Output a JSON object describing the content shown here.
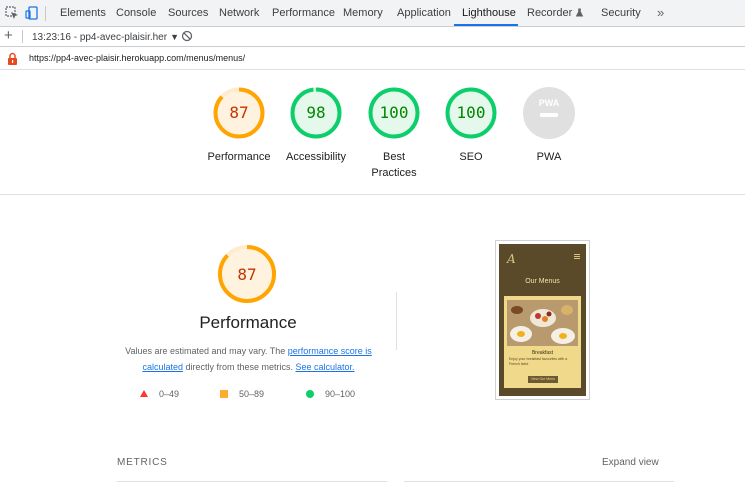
{
  "devtools": {
    "tabs": [
      "Elements",
      "Console",
      "Sources",
      "Network",
      "Performance",
      "Memory",
      "Application",
      "Lighthouse",
      "Recorder",
      "Security"
    ],
    "active_tab": "Lighthouse",
    "more_label": "»",
    "accent": "#1a73e8"
  },
  "report_toolbar": {
    "add_label": "+",
    "selected_report": "13:23:16 - pp4-avec-plaisir.her",
    "caret": "▼"
  },
  "url": "https://pp4-avec-plaisir.herokuapp.com/menus/menus/",
  "summary_gauges": [
    {
      "label": "Performance",
      "score": "87",
      "value": 0.87,
      "rating": "average"
    },
    {
      "label": "Accessibility",
      "score": "98",
      "value": 0.98,
      "rating": "pass"
    },
    {
      "label": "Best Practices",
      "score": "100",
      "value": 1.0,
      "rating": "pass"
    },
    {
      "label": "SEO",
      "score": "100",
      "value": 1.0,
      "rating": "pass"
    },
    {
      "label": "PWA",
      "score": "",
      "value": 0,
      "rating": "na",
      "badge": "PWA"
    }
  ],
  "category": {
    "score": "87",
    "value": 0.87,
    "title": "Performance",
    "desc_prefix": "Values are estimated and may vary. The ",
    "desc_link1": "performance score is calculated",
    "desc_middle": " directly from these metrics. ",
    "desc_link2": "See calculator."
  },
  "legend": [
    {
      "range": "0–49",
      "shape": "triangle",
      "color": "#ff3333"
    },
    {
      "range": "50–89",
      "shape": "square",
      "color": "#ffaa33"
    },
    {
      "range": "90–100",
      "shape": "circle",
      "color": "#0cce6b"
    }
  ],
  "thumbnail": {
    "logo": "A",
    "title": "Our Menus",
    "card_title": "Breakfast",
    "card_text": "Enjoy your breakfast favourites with a French twist.",
    "button": "View Our Menu"
  },
  "metrics": {
    "label": "METRICS",
    "expand": "Expand view"
  },
  "colors": {
    "average": "#ffa400",
    "average_text": "#c33300",
    "pass": "#0cce6b",
    "pass_text": "#008800",
    "na": "#e0e0e0"
  }
}
